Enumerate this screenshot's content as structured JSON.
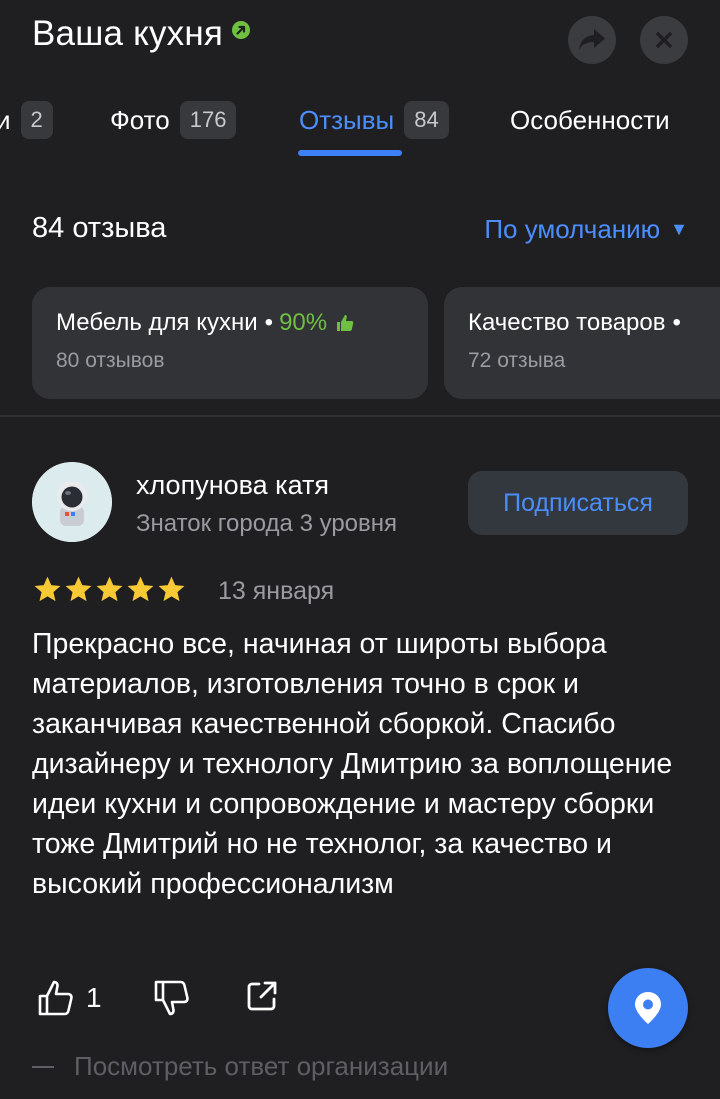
{
  "header": {
    "title": "Ваша кухня",
    "verified_icon": "verified-badge-icon",
    "share_icon": "share-arrow-icon",
    "close_icon": "close-icon"
  },
  "tabs": [
    {
      "label": "Услуги",
      "visible_label": "и",
      "count": "2"
    },
    {
      "label": "Фото",
      "count": "176"
    },
    {
      "label": "Отзывы",
      "count": "84",
      "active": true
    },
    {
      "label": "Особенности",
      "count": ""
    }
  ],
  "reviews": {
    "count_label": "84 отзыва",
    "sort_label": "По умолчанию",
    "sort_arrow": "▼"
  },
  "aspects": [
    {
      "name": "Мебель для кухни",
      "separator": "•",
      "percent": "90%",
      "reviews": "80 отзывов"
    },
    {
      "name": "Качество товаров",
      "separator": "•",
      "percent": "",
      "reviews": "72 отзыва"
    }
  ],
  "review": {
    "author": "хлопунова катя",
    "level": "Знаток города 3 уровня",
    "subscribe_label": "Подписаться",
    "rating": 5,
    "date": "13 января",
    "text": "Прекрасно все, начиная от широты выбора материалов, изготовления точно в срок и заканчивая качественной сборкой. Спасибо дизайнеру и технологу Дмитрию за воплощение идеи кухни и сопровождение и мастеру сборки тоже Дмитрий но не технолог, за качество и высокий профессионализм",
    "likes": "1",
    "org_reply_label": "Посмотреть ответ организации"
  },
  "colors": {
    "background": "#1f1f22",
    "accent": "#4b8ffe",
    "positive": "#6fbf40",
    "star": "#f7c934"
  }
}
